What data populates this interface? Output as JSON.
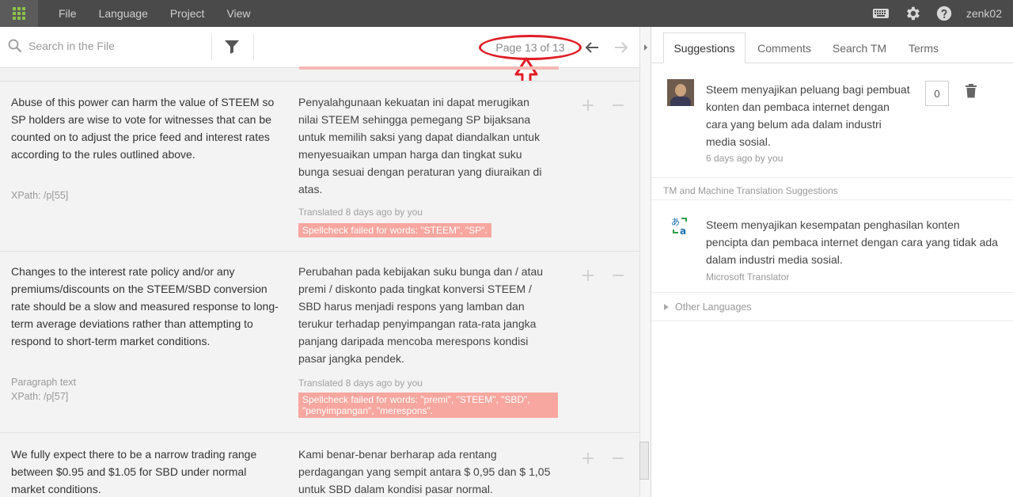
{
  "menu": {
    "items": [
      {
        "label": "File"
      },
      {
        "label": "Language"
      },
      {
        "label": "Project"
      },
      {
        "label": "View"
      }
    ],
    "username": "zenk02",
    "icons": [
      "apps-icon",
      "keyboard-icon",
      "gear-icon",
      "help-icon"
    ]
  },
  "toolbar": {
    "search_placeholder": "Search in the File",
    "page_indicator": "Page 13 of 13",
    "annotation_color": "#e01e27"
  },
  "segments": [
    {
      "source": "Abuse of this power can harm the value of STEEM so SP holders are wise to vote for witnesses that can be counted on to adjust the price feed and interest rates according to the rules outlined above.",
      "note": "",
      "xpath": "XPath: /p[55]",
      "target": "Penyalahgunaan kekuatan ini dapat merugikan nilai STEEM sehingga pemegang SP bijaksana untuk memilih saksi yang dapat diandalkan untuk menyesuaikan umpan harga dan tingkat suku bunga sesuai dengan peraturan yang diuraikan di atas.",
      "translated_meta": "Translated 8 days ago by you",
      "spellcheck": "Spellcheck failed for words: \"STEEM\", \"SP\"."
    },
    {
      "source": "Changes to the interest rate policy and/or any premiums/discounts on the STEEM/SBD conversion rate should be a slow and measured response to long-term average deviations rather than attempting to respond to short-term market conditions.",
      "note": "Paragraph text",
      "xpath": "XPath: /p[57]",
      "target": "Perubahan pada kebijakan suku bunga dan / atau premi / diskonto pada tingkat konversi STEEM / SBD harus menjadi respons yang lamban dan terukur terhadap penyimpangan rata-rata jangka panjang daripada mencoba merespons kondisi pasar jangka pendek.",
      "translated_meta": "Translated 8 days ago by you",
      "spellcheck": "Spellcheck failed for words: \"premi\", \"STEEM\", \"SBD\", \"penyimpangan\", \"merespons\"."
    },
    {
      "source": "We fully expect there to be a narrow trading range between $0.95 and $1.05 for SBD under normal market conditions.",
      "target": "Kami benar-benar berharap ada rentang perdagangan yang sempit antara $ 0,95 dan $ 1,05 untuk SBD dalam kondisi pasar normal."
    }
  ],
  "actions": {
    "add": "+",
    "remove": "−"
  },
  "panel": {
    "tabs": [
      {
        "label": "Suggestions"
      },
      {
        "label": "Comments"
      },
      {
        "label": "Search TM"
      },
      {
        "label": "Terms"
      }
    ],
    "suggestion": {
      "text": "Steem menyajikan peluang bagi pembuat konten dan pembaca internet dengan cara yang belum ada dalam industri media sosial.",
      "meta": "6 days ago by you",
      "votes": "0"
    },
    "tm_header": "TM and Machine Translation Suggestions",
    "tm": {
      "text": "Steem menyajikan kesempatan penghasilan konten pencipta dan pembaca internet dengan cara yang tidak ada dalam industri media sosial.",
      "source": "Microsoft Translator"
    },
    "other_languages": "Other Languages"
  }
}
